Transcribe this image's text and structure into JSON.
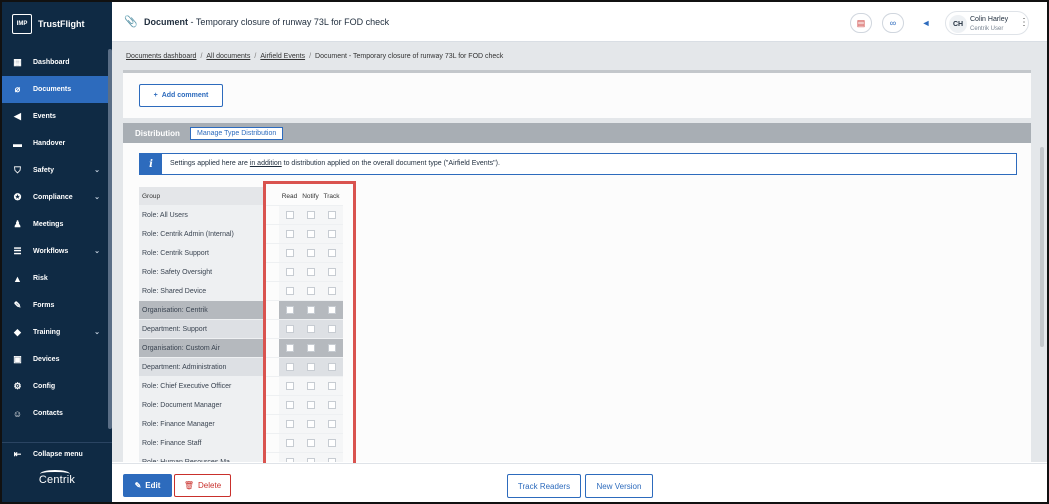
{
  "brand": {
    "logo": "IMP",
    "name": "TrustFlight"
  },
  "sidebar": {
    "items": [
      {
        "label": "Dashboard",
        "icon": "dashboard-icon",
        "chevron": false
      },
      {
        "label": "Documents",
        "icon": "paperclip-icon",
        "chevron": false,
        "active": true
      },
      {
        "label": "Events",
        "icon": "megaphone-icon",
        "chevron": false
      },
      {
        "label": "Handover",
        "icon": "handover-icon",
        "chevron": false
      },
      {
        "label": "Safety",
        "icon": "shield-icon",
        "chevron": true
      },
      {
        "label": "Compliance",
        "icon": "badge-icon",
        "chevron": true
      },
      {
        "label": "Meetings",
        "icon": "meetings-icon",
        "chevron": false
      },
      {
        "label": "Workflows",
        "icon": "workflow-icon",
        "chevron": true
      },
      {
        "label": "Risk",
        "icon": "warning-icon",
        "chevron": false
      },
      {
        "label": "Forms",
        "icon": "forms-icon",
        "chevron": false
      },
      {
        "label": "Training",
        "icon": "graduation-cap-icon",
        "chevron": true
      },
      {
        "label": "Devices",
        "icon": "devices-icon",
        "chevron": false
      },
      {
        "label": "Config",
        "icon": "config-icon",
        "chevron": false
      },
      {
        "label": "Contacts",
        "icon": "contacts-icon",
        "chevron": false
      }
    ],
    "collapse_label": "Collapse menu",
    "footer_logo": "Centrik"
  },
  "header": {
    "doc_label": "Document",
    "title_sep": " - ",
    "title": "Temporary closure of runway 73L for FOD check",
    "user": {
      "initials": "CH",
      "name": "Colin Harley",
      "role": "Centrik User"
    }
  },
  "breadcrumb": {
    "items": [
      "Documents dashboard",
      "All documents",
      "Airfield Events"
    ],
    "current": "Document - Temporary closure of runway 73L for FOD check",
    "sep": "/"
  },
  "comments": {
    "add_label": "Add comment"
  },
  "distribution": {
    "title": "Distribution",
    "manage_label": "Manage Type Distribution",
    "info_prefix": "Settings applied here are ",
    "info_link": "in addition",
    "info_suffix": " to distribution applied on the overall document type (\"Airfield Events\").",
    "columns": {
      "group": "Group",
      "read": "Read",
      "notify": "Notify",
      "track": "Track"
    },
    "rows": [
      {
        "name": "Role: All Users",
        "style": "normal"
      },
      {
        "name": "Role: Centrik Admin (Internal)",
        "style": "normal"
      },
      {
        "name": "Role: Centrik Support",
        "style": "normal"
      },
      {
        "name": "Role: Safety Oversight",
        "style": "normal"
      },
      {
        "name": "Role: Shared Device",
        "style": "normal"
      },
      {
        "name": "Organisation: Centrik",
        "style": "shaded"
      },
      {
        "name": "Department: Support",
        "style": "light"
      },
      {
        "name": "Organisation: Custom Air",
        "style": "shaded"
      },
      {
        "name": "Department: Administration",
        "style": "light"
      },
      {
        "name": "Role: Chief Executive Officer",
        "style": "normal"
      },
      {
        "name": "Role: Document Manager",
        "style": "normal"
      },
      {
        "name": "Role: Finance Manager",
        "style": "normal"
      },
      {
        "name": "Role: Finance Staff",
        "style": "normal"
      },
      {
        "name": "Role: Human Resources Ma...",
        "style": "normal"
      }
    ]
  },
  "footer": {
    "edit_label": "Edit",
    "delete_label": "Delete",
    "track_readers_label": "Track Readers",
    "new_version_label": "New Version"
  },
  "colors": {
    "sidebar_bg": "#0f2a44",
    "accent": "#2d6bbd",
    "danger": "#c9302c",
    "highlight": "#d9534f"
  }
}
